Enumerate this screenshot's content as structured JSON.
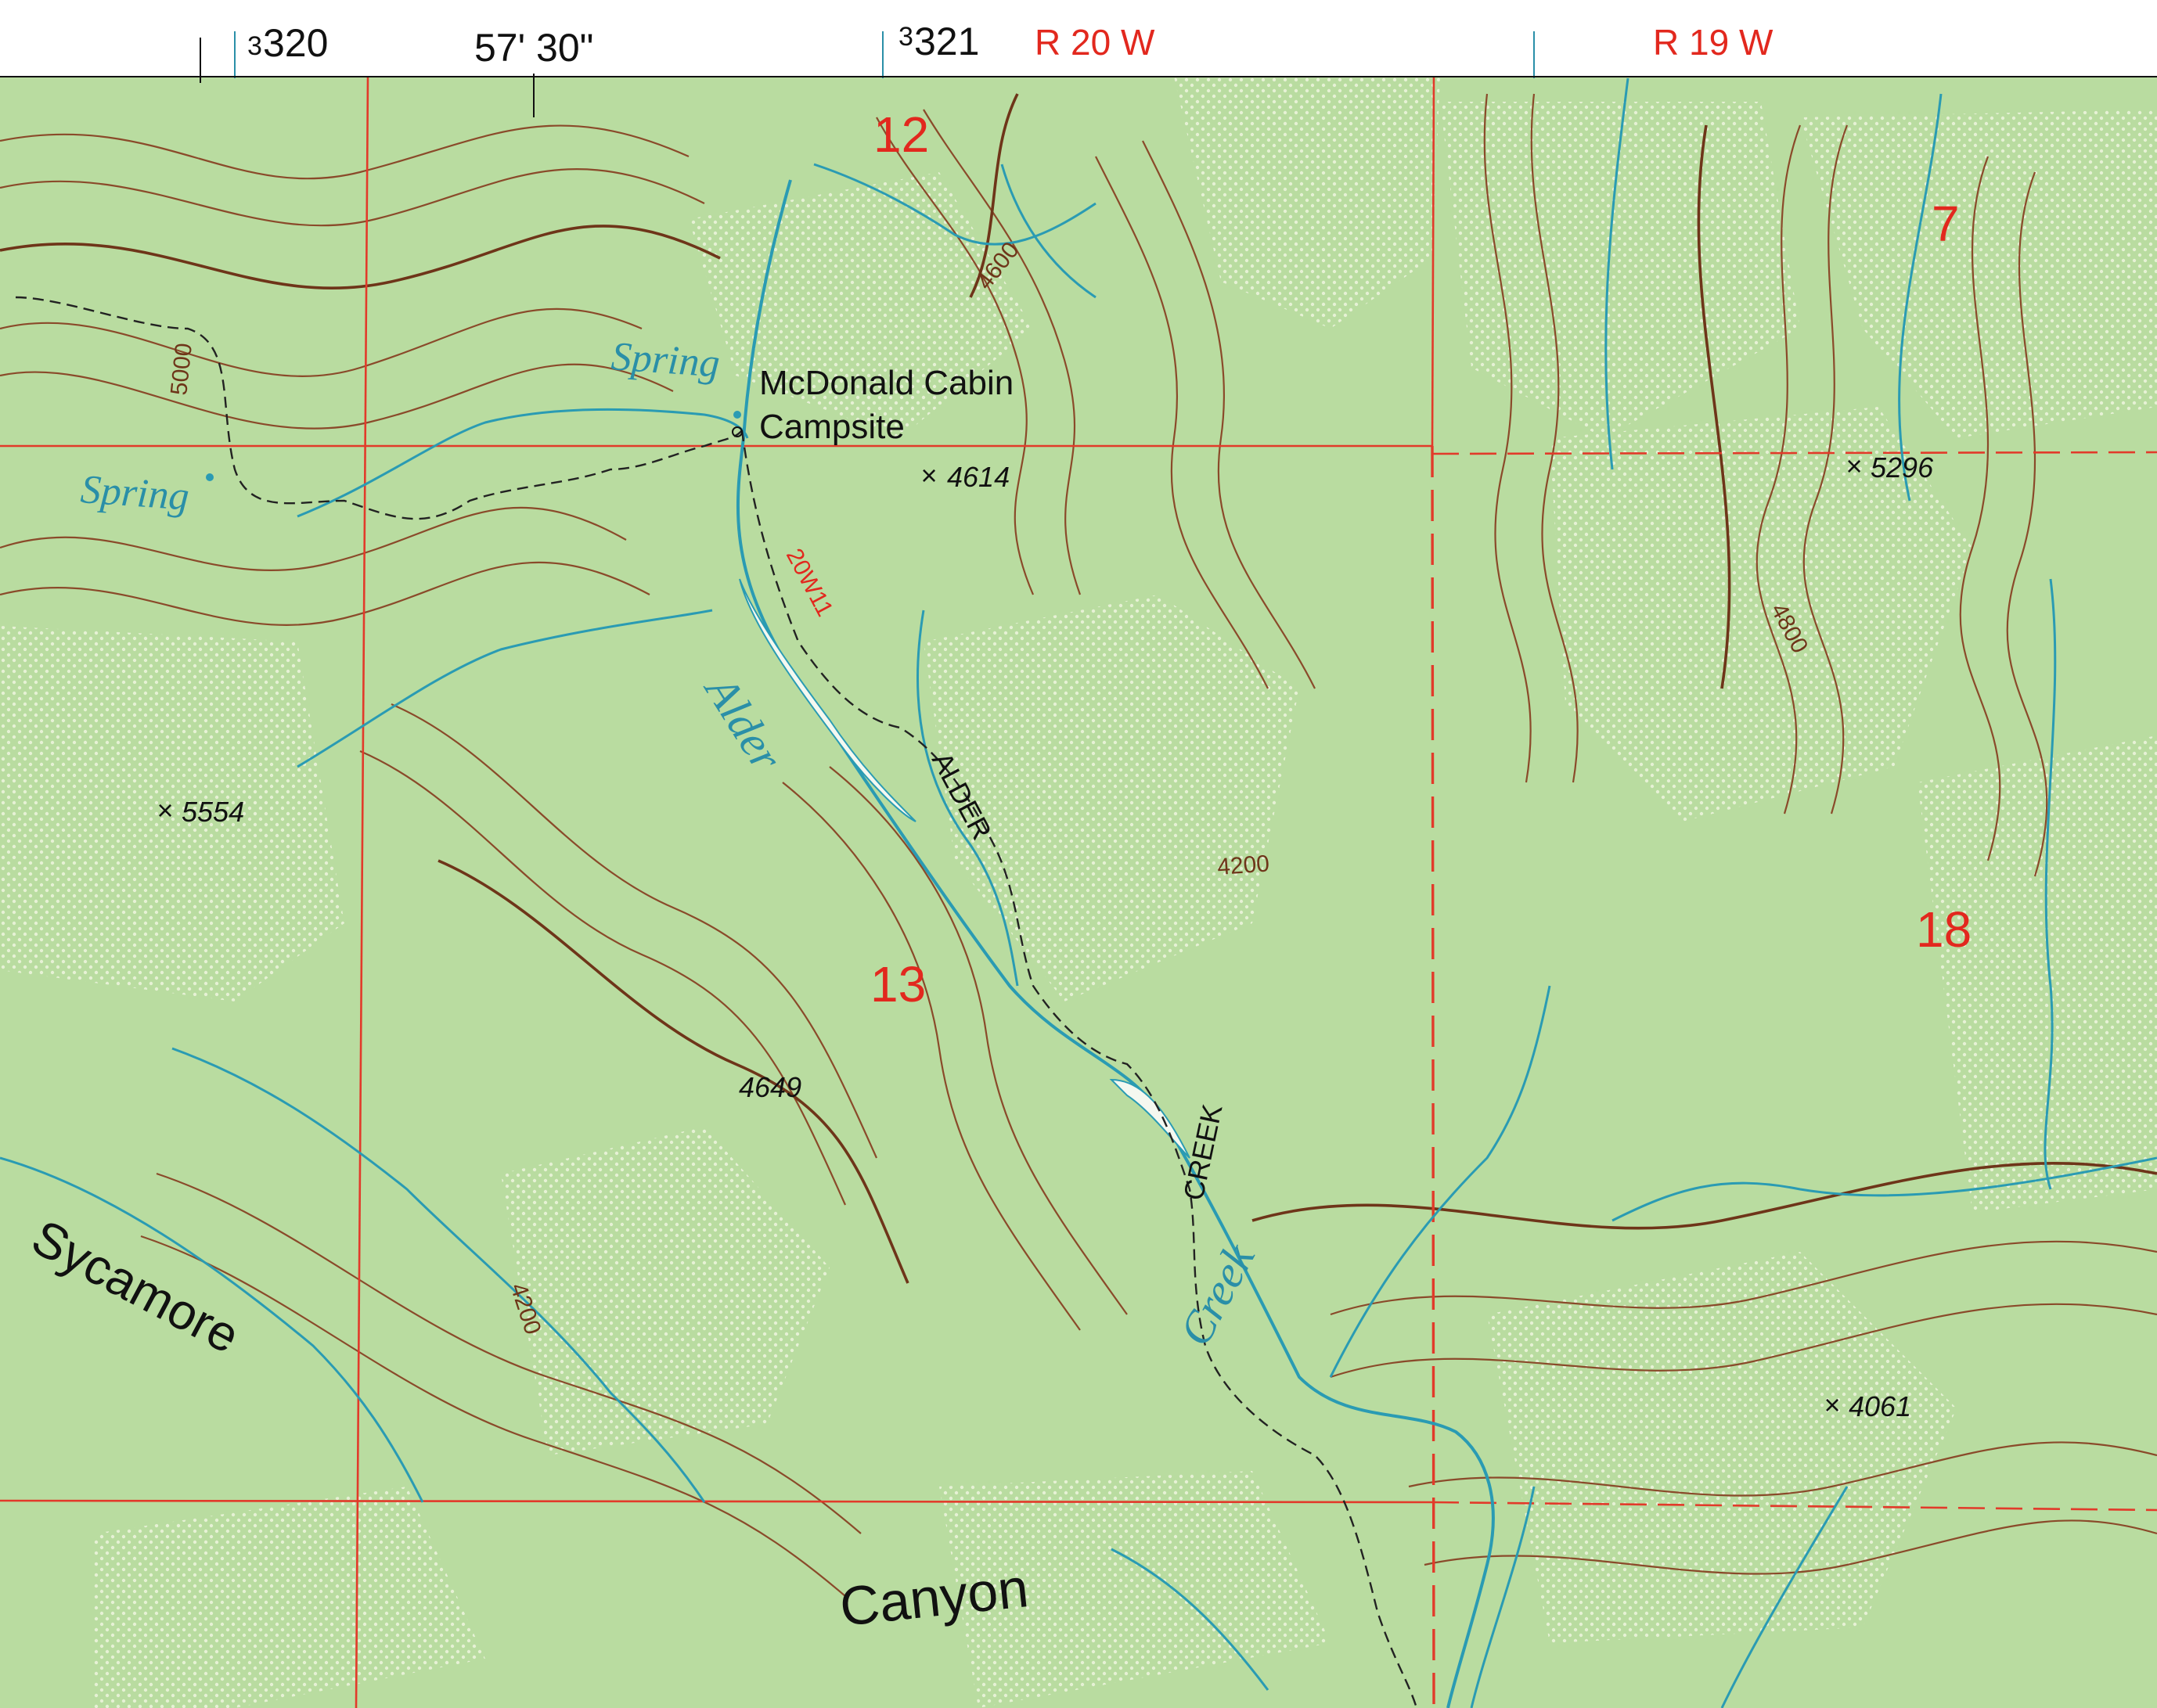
{
  "colors": {
    "vegetation": "#b9dca0",
    "vegetation_dark": "#a9d28c",
    "open_ground": "#eef2df",
    "contour": "#8a4a2a",
    "contour_index": "#6e3519",
    "water": "#2a9bb3",
    "grid_red": "#e23a2a",
    "trail": "#222222",
    "text_black": "#111111",
    "text_red": "#e2281e",
    "text_blue": "#2a8fa8"
  },
  "margin": {
    "easting_320": "320",
    "easting_321": "321",
    "easting_super": "3",
    "longitude": "57' 30\"",
    "range_left": "R 20 W",
    "range_right": "R 19 W"
  },
  "sections": {
    "s12": "12",
    "s7": "7",
    "s13": "13",
    "s18": "18"
  },
  "places": {
    "cabin_line1": "McDonald Cabin",
    "cabin_line2": "Campsite",
    "spring_1": "Spring",
    "spring_2": "Spring",
    "alder_water": "Alder",
    "creek_water": "Creek",
    "alder_trail": "ALDER",
    "creek_trail": "CREEK",
    "sycamore": "Sycamore",
    "canyon": "Canyon",
    "trail_number": "20W11"
  },
  "elevations": {
    "spot_4614": "4614",
    "spot_5296": "5296",
    "spot_5554": "5554",
    "spot_4649": "4649",
    "spot_4061": "4061",
    "contour_4600": "4600",
    "contour_5000": "5000",
    "contour_4800": "4800",
    "contour_4200_a": "4200",
    "contour_4200_b": "4200",
    "spot_marker": "×"
  }
}
